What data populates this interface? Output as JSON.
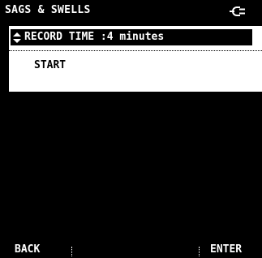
{
  "header": {
    "title": "SAGS & SWELLS",
    "status_icon": "mains-power-plug-icon"
  },
  "menu": {
    "items": [
      {
        "icon": "up-down-arrows-icon",
        "label": "RECORD TIME :4 minutes",
        "selected": true
      },
      {
        "label": "START",
        "selected": false
      }
    ]
  },
  "softkeys": {
    "left": "BACK",
    "right": "ENTER"
  },
  "colors": {
    "background": "#000000",
    "panel": "#ffffff",
    "highlight": "#000000",
    "text": "#ffffff"
  }
}
